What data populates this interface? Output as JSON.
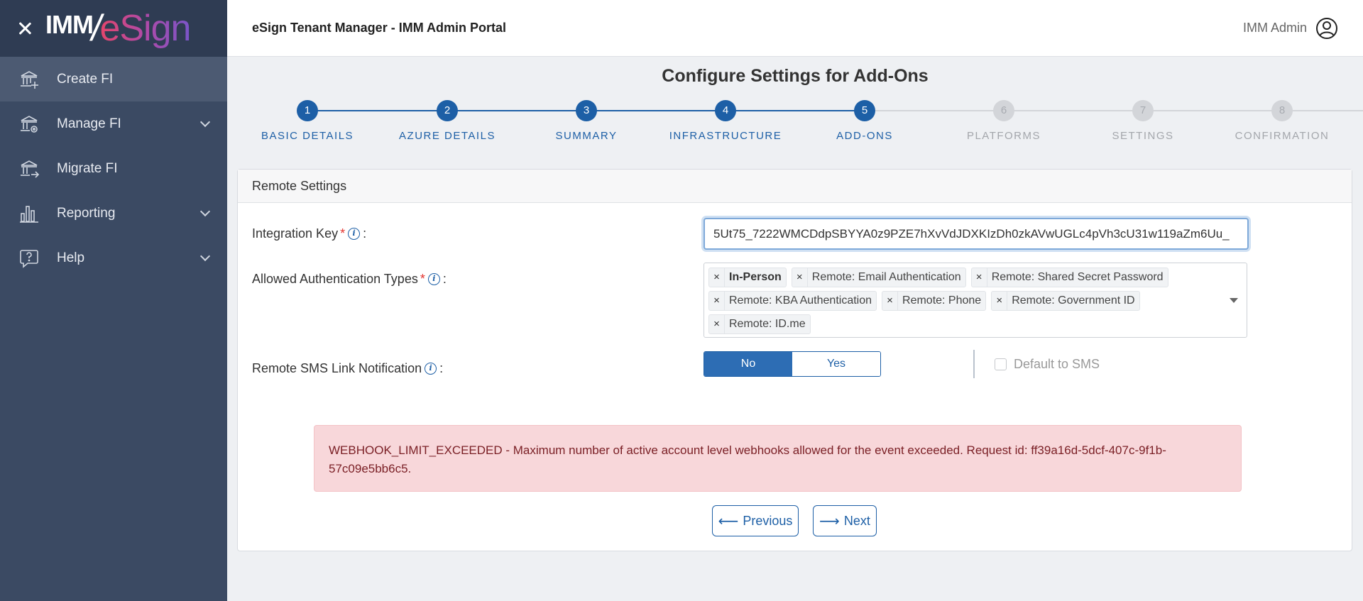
{
  "app": {
    "title": "eSign Tenant Manager - IMM Admin Portal",
    "logo_part1": "IMM",
    "logo_slash": "/",
    "logo_part2": "eSign",
    "user_name": "IMM Admin"
  },
  "sidebar": {
    "items": [
      {
        "label": "Create FI",
        "icon": "bank-plus-icon",
        "active": true,
        "expandable": false
      },
      {
        "label": "Manage FI",
        "icon": "bank-gear-icon",
        "active": false,
        "expandable": true
      },
      {
        "label": "Migrate FI",
        "icon": "bank-arrow-icon",
        "active": false,
        "expandable": false
      },
      {
        "label": "Reporting",
        "icon": "bar-chart-icon",
        "active": false,
        "expandable": true
      },
      {
        "label": "Help",
        "icon": "help-bubble-icon",
        "active": false,
        "expandable": true
      }
    ]
  },
  "page": {
    "title": "Configure Settings for Add-Ons"
  },
  "stepper": {
    "current": 5,
    "steps": [
      {
        "num": "1",
        "label": "BASIC DETAILS",
        "status": "done"
      },
      {
        "num": "2",
        "label": "AZURE DETAILS",
        "status": "done"
      },
      {
        "num": "3",
        "label": "SUMMARY",
        "status": "done"
      },
      {
        "num": "4",
        "label": "INFRASTRUCTURE",
        "status": "done"
      },
      {
        "num": "5",
        "label": "ADD-ONS",
        "status": "done"
      },
      {
        "num": "6",
        "label": "PLATFORMS",
        "status": "todo"
      },
      {
        "num": "7",
        "label": "SETTINGS",
        "status": "todo"
      },
      {
        "num": "8",
        "label": "CONFIRMATION",
        "status": "todo"
      }
    ]
  },
  "form": {
    "section_title": "Remote Settings",
    "integration_key": {
      "label": "Integration Key",
      "required_mark": "*",
      "colon": ":",
      "value": "5Ut75_7222WMCDdpSBYYA0z9PZE7hXvVdJDXKIzDh0zkAVwUGLc4pVh3cU31w119aZm6Uu_"
    },
    "auth_types": {
      "label": "Allowed Authentication Types",
      "required_mark": "*",
      "colon": ":",
      "tags": [
        {
          "label": "In-Person",
          "bold": true
        },
        {
          "label": "Remote: Email Authentication",
          "bold": false
        },
        {
          "label": "Remote: Shared Secret Password",
          "bold": false
        },
        {
          "label": "Remote: KBA Authentication",
          "bold": false
        },
        {
          "label": "Remote: Phone",
          "bold": false
        },
        {
          "label": "Remote: Government ID",
          "bold": false
        },
        {
          "label": "Remote: ID.me",
          "bold": false
        }
      ],
      "remove_glyph": "×"
    },
    "sms": {
      "label": "Remote SMS Link Notification",
      "colon": ":",
      "no_label": "No",
      "yes_label": "Yes",
      "selected": "No",
      "default_label": "Default to SMS",
      "default_checked": false
    },
    "info_glyph": "i"
  },
  "alert": {
    "message": "WEBHOOK_LIMIT_EXCEEDED - Maximum number of active account level webhooks allowed for the event exceeded. Request id: ff39a16d-5dcf-407c-9f1b-57c09e5bb6c5."
  },
  "buttons": {
    "previous": "Previous",
    "next": "Next",
    "previous_arrow": "⟵",
    "next_arrow": "⟶"
  },
  "colors": {
    "sidebar": "#3b4a63",
    "primary": "#1d5fa6",
    "alert_bg": "#f8d7da",
    "alert_text": "#7a1f25"
  }
}
